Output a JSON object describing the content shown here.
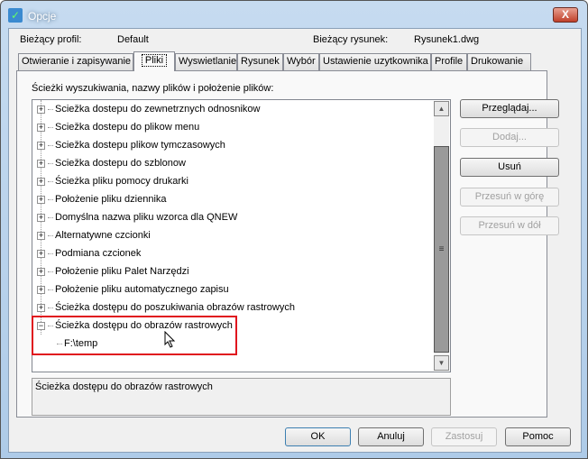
{
  "window": {
    "title": "Opcje",
    "close_label": "X"
  },
  "header": {
    "profile_label": "Bieżący profil:",
    "profile_value": "Default",
    "drawing_label": "Bieżący rysunek:",
    "drawing_value": "Rysunek1.dwg"
  },
  "tabs": [
    {
      "label": "Otwieranie i zapisywanie"
    },
    {
      "label": "Pliki"
    },
    {
      "label": "Wyswietlanie"
    },
    {
      "label": "Rysunek"
    },
    {
      "label": "Wybór"
    },
    {
      "label": "Ustawienie uzytkownika"
    },
    {
      "label": "Profile"
    },
    {
      "label": "Drukowanie"
    }
  ],
  "active_tab": "Pliki",
  "panel": {
    "heading": "Ścieżki wyszukiwania, nazwy plików i położenie plików:"
  },
  "tree": [
    {
      "label": "Sciežka dostepu do zewnetrznych odnosnikow",
      "expanded": false
    },
    {
      "label": "Sciežka dostepu do plikow menu",
      "expanded": false
    },
    {
      "label": "Sciežka dostepu plikow tymczasowych",
      "expanded": false
    },
    {
      "label": "Sciežka dostepu do szblonow",
      "expanded": false
    },
    {
      "label": "Ścieżka pliku pomocy drukarki",
      "expanded": false
    },
    {
      "label": "Położenie pliku dziennika",
      "expanded": false
    },
    {
      "label": "Domyślna nazwa pliku wzorca dla QNEW",
      "expanded": false
    },
    {
      "label": "Alternatywne czcionki",
      "expanded": false
    },
    {
      "label": "Podmiana czcionek",
      "expanded": false
    },
    {
      "label": "Położenie pliku Palet Narzędzi",
      "expanded": false
    },
    {
      "label": "Położenie pliku automatycznego zapisu",
      "expanded": false
    },
    {
      "label": "Ścieżka dostępu do poszukiwania obrazów rastrowych",
      "expanded": false
    },
    {
      "label": "Ścieżka dostępu do obrazów rastrowych",
      "expanded": true
    }
  ],
  "tree_child": "F:\\temp",
  "status_text": "Ścieżka dostępu do obrazów rastrowych",
  "side_buttons": [
    {
      "label": "Przeglądaj...",
      "enabled": true
    },
    {
      "label": "Dodaj...",
      "enabled": false
    },
    {
      "label": "Usuń",
      "enabled": true
    },
    {
      "label": "Przesuń w górę",
      "enabled": false
    },
    {
      "label": "Przesuń w dół",
      "enabled": false
    }
  ],
  "bottom_buttons": [
    {
      "label": "OK",
      "enabled": true
    },
    {
      "label": "Anuluj",
      "enabled": true
    },
    {
      "label": "Zastosuj",
      "enabled": false
    },
    {
      "label": "Pomoc",
      "enabled": true
    }
  ],
  "colors": {
    "highlight": "#e0141e",
    "accent": "#3c7fb1"
  }
}
